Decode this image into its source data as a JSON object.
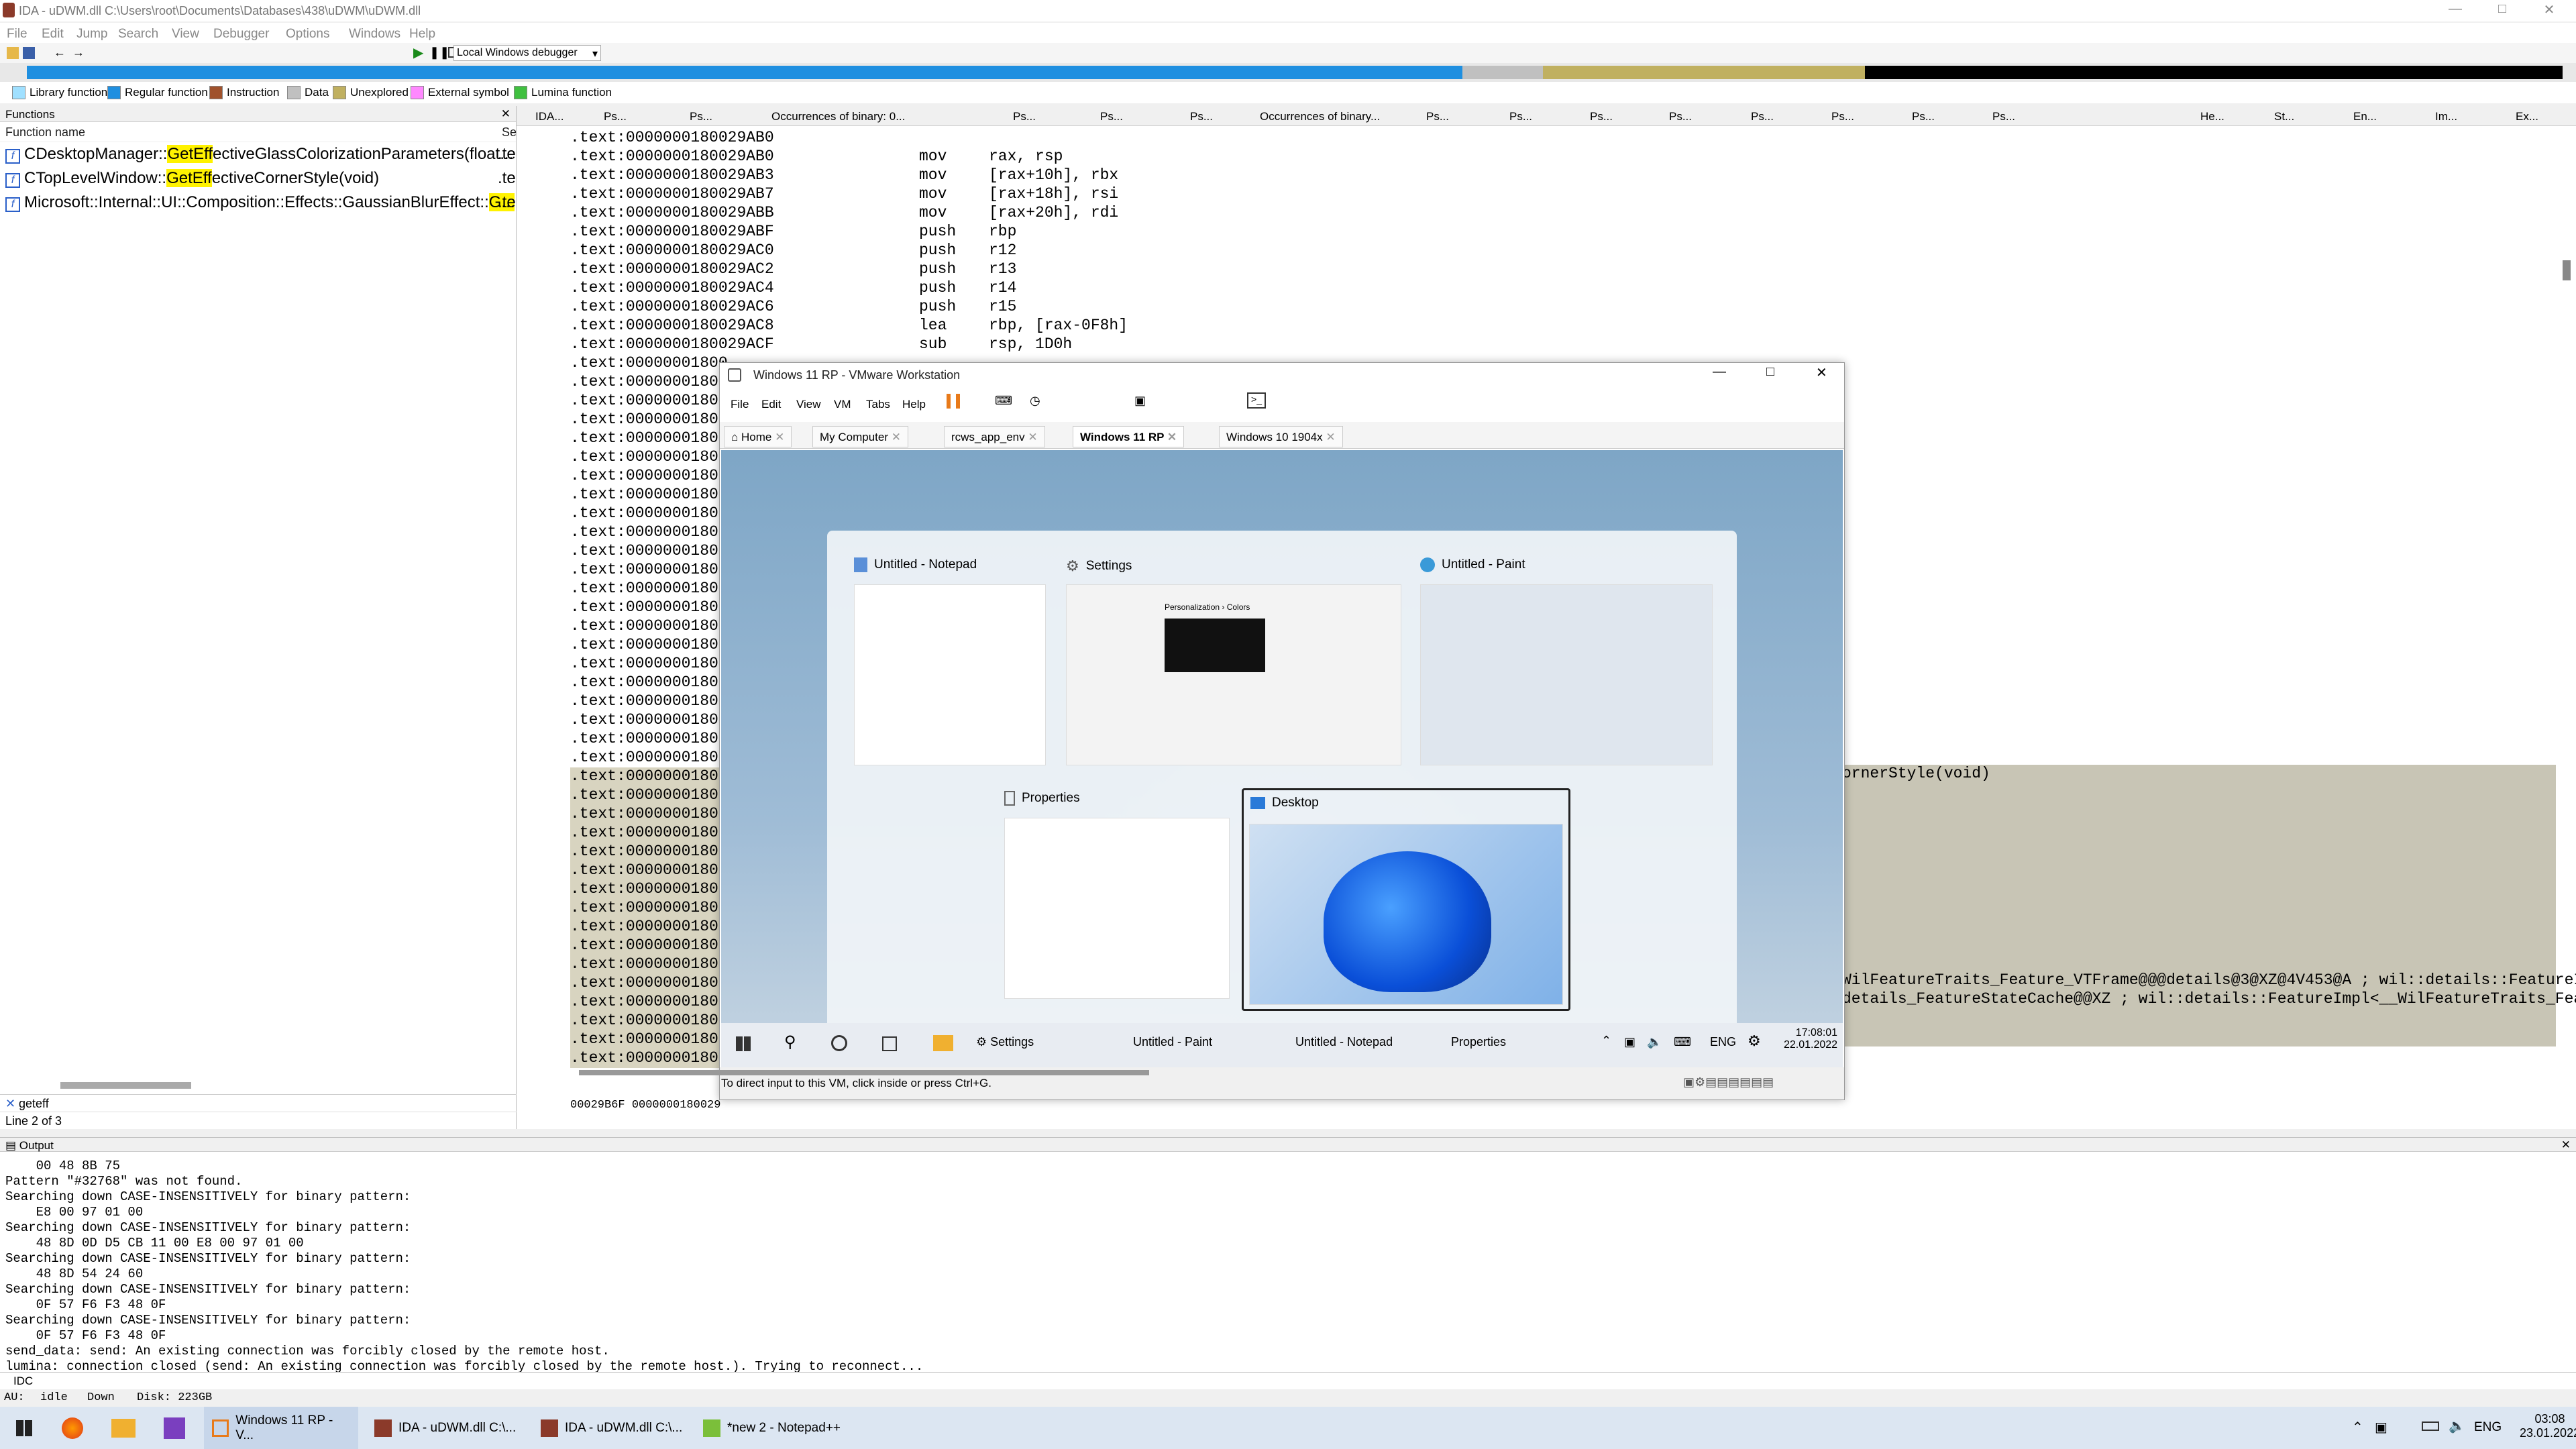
{
  "window": {
    "title": "IDA - uDWM.dll C:\\Users\\root\\Documents\\Databases\\438\\uDWM\\uDWM.dll"
  },
  "menu": [
    "File",
    "Edit",
    "Jump",
    "Search",
    "View",
    "Debugger",
    "Options",
    "Windows",
    "Help"
  ],
  "toolbar": {
    "debugger_select": "Local Windows debugger"
  },
  "legend": [
    {
      "label": "Library function",
      "color": "#a0e0ff"
    },
    {
      "label": "Regular function",
      "color": "#1f8fe0"
    },
    {
      "label": "Instruction",
      "color": "#a0522d"
    },
    {
      "label": "Data",
      "color": "#c0c0c0"
    },
    {
      "label": "Unexplored",
      "color": "#c0b060"
    },
    {
      "label": "External symbol",
      "color": "#ff88ff"
    },
    {
      "label": "Lumina function",
      "color": "#40c040"
    }
  ],
  "functions": {
    "title": "Functions",
    "column": "Function name",
    "column2": "Se",
    "rows": [
      {
        "pre": "CDesktopManager::",
        "hl": "GetEff",
        "post": "ectiveGlassColorizationParameters(float...",
        "seg": ".te"
      },
      {
        "pre": "CTopLevelWindow::",
        "hl": "GetEff",
        "post": "ectiveCornerStyle(void)",
        "seg": ".te"
      },
      {
        "pre": "Microsoft::Internal::UI::Composition::Effects::GaussianBlurEffect::",
        "hl": "G...",
        "post": "",
        "seg": ".te"
      }
    ],
    "filter": "geteff",
    "status": "Line 2 of 3"
  },
  "tabs": [
    "IDA...",
    "Ps...",
    "Ps...",
    "Occurrences of binary: 0...",
    "Ps...",
    "Ps...",
    "Ps...",
    "Occurrences of binary...",
    "Ps...",
    "Ps...",
    "Ps...",
    "Ps...",
    "Ps...",
    "Ps...",
    "Ps...",
    "Ps...",
    "He...",
    "St...",
    "En...",
    "Im...",
    "Ex..."
  ],
  "disasm": {
    "lines": [
      {
        "addr": ".text:0000000180029AB0",
        "mn": "",
        "op": ""
      },
      {
        "addr": ".text:0000000180029AB0",
        "mn": "mov",
        "op": "rax, rsp"
      },
      {
        "addr": ".text:0000000180029AB3",
        "mn": "mov",
        "op": "[rax+10h], rbx"
      },
      {
        "addr": ".text:0000000180029AB7",
        "mn": "mov",
        "op": "[rax+18h], rsi"
      },
      {
        "addr": ".text:0000000180029ABB",
        "mn": "mov",
        "op": "[rax+20h], rdi"
      },
      {
        "addr": ".text:0000000180029ABF",
        "mn": "push",
        "op": "rbp"
      },
      {
        "addr": ".text:0000000180029AC0",
        "mn": "push",
        "op": "r12"
      },
      {
        "addr": ".text:0000000180029AC2",
        "mn": "push",
        "op": "r13"
      },
      {
        "addr": ".text:0000000180029AC4",
        "mn": "push",
        "op": "r14"
      },
      {
        "addr": ".text:0000000180029AC6",
        "mn": "push",
        "op": "r15"
      },
      {
        "addr": ".text:0000000180029AC8",
        "mn": "lea",
        "op": "rbp, [rax-0F8h]"
      },
      {
        "addr": ".text:0000000180029ACF",
        "mn": "sub",
        "op": "rsp, 1D0h"
      }
    ],
    "truncated_addr": ".text:00000001800",
    "right_frag1": "ornerStyle(void)",
    "right_frag2": "WilFeatureTraits_Feature_VTFrame@@@details@3@XZ@4V453@A ; wil::details::FeatureImp",
    "right_frag3": "details_FeatureStateCache@@XZ ; wil::details::FeatureImpl<__WilFeatureTraits_Featu",
    "footer": "00029B6F 0000000180029"
  },
  "vmware": {
    "title": "Windows 11 RP - VMware Workstation",
    "menu": [
      "File",
      "Edit",
      "View",
      "VM",
      "Tabs",
      "Help"
    ],
    "tabs": [
      "Home",
      "My Computer",
      "rcws_app_env",
      "Windows 11 RP",
      "Windows 10 1904x"
    ],
    "alttab": [
      "Untitled - Notepad",
      "Settings",
      "Untitled - Paint",
      "Properties",
      "Desktop"
    ],
    "settings_heading": "Personalization › Colors",
    "guest_taskbar": [
      "Settings",
      "Untitled - Paint",
      "Untitled - Notepad",
      "Properties"
    ],
    "guest_lang": "ENG",
    "guest_time": "17:08:01",
    "guest_date": "22.01.2022",
    "status": "To direct input to this VM, click inside or press Ctrl+G."
  },
  "output": {
    "title": "Output",
    "lines": [
      "    00 48 8B 75",
      "Pattern \"#32768\" was not found.",
      "Searching down CASE-INSENSITIVELY for binary pattern:",
      "    E8 00 97 01 00",
      "Searching down CASE-INSENSITIVELY for binary pattern:",
      "    48 8D 0D D5 CB 11 00 E8 00 97 01 00",
      "Searching down CASE-INSENSITIVELY for binary pattern:",
      "    48 8D 54 24 60",
      "Searching down CASE-INSENSITIVELY for binary pattern:",
      "    0F 57 F6 F3 48 0F",
      "Searching down CASE-INSENSITIVELY for binary pattern:",
      "    0F 57 F6 F3 48 0F",
      "send_data: send: An existing connection was forcibly closed by the remote host.",
      "lumina: connection closed (send: An existing connection was forcibly closed by the remote host.). Trying to reconnect..."
    ],
    "idc": "IDC"
  },
  "status": {
    "au": "AU:",
    "state": "idle",
    "dir": "Down",
    "disk": "Disk: 223GB"
  },
  "taskbar": {
    "items": [
      "Windows 11 RP - V...",
      "IDA - uDWM.dll C:\\...",
      "IDA - uDWM.dll C:\\...",
      "*new 2 - Notepad++"
    ],
    "lang": "ENG",
    "time": "03:08",
    "date": "23.01.2022"
  }
}
